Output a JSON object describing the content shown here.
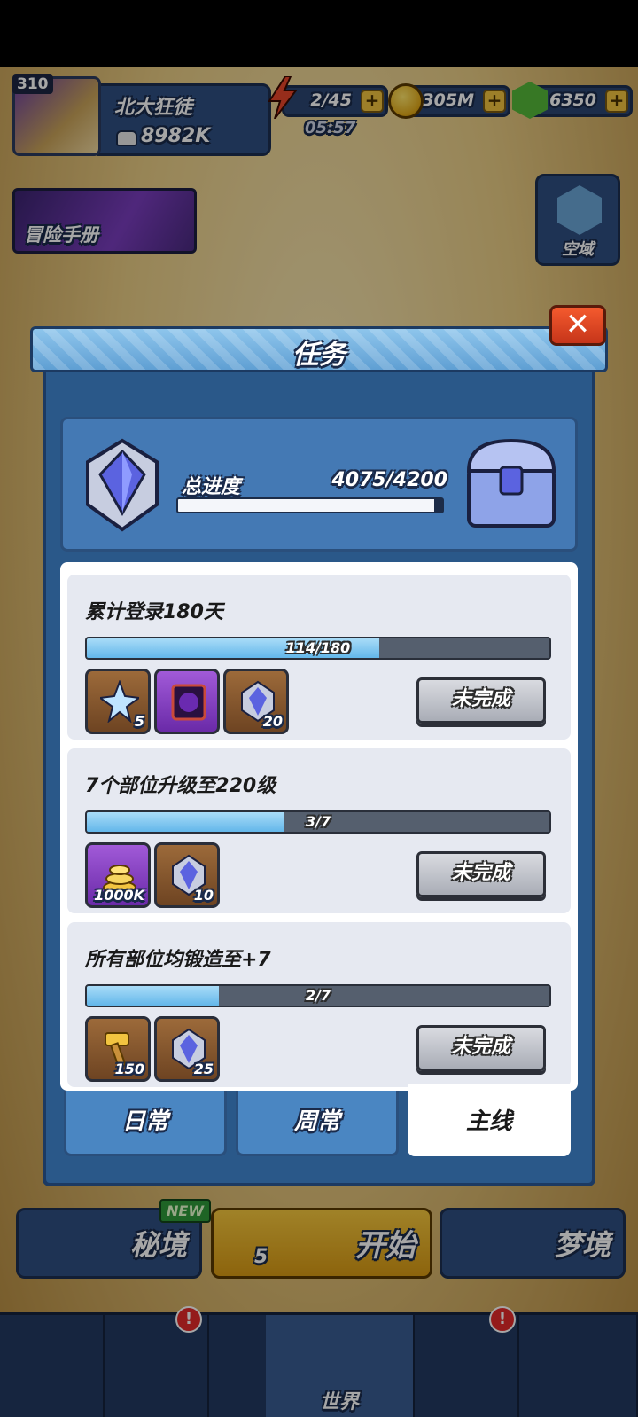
{
  "hud": {
    "level": "310",
    "player_name": "北大狂徒",
    "power": "8982K",
    "energy": "2/45",
    "energy_timer": "05:57",
    "gold": "305M",
    "gems": "6350",
    "plus_label": "+",
    "adventure_book": "冒险手册",
    "airspace": "空域"
  },
  "modal": {
    "title": "任务",
    "close_label": "✕",
    "total_progress_label": "总进度",
    "total_progress_value": "4075/4200",
    "total_progress_fraction": 0.97
  },
  "tasks": [
    {
      "title": "累计登录180天",
      "progress_text": "114/180",
      "progress_fraction": 0.633,
      "rewards": [
        {
          "icon": "star-shard-icon",
          "count": "5",
          "style": "brown"
        },
        {
          "icon": "dark-portal-frame-icon",
          "count": "",
          "style": "purple"
        },
        {
          "icon": "crystal-badge-icon",
          "count": "20",
          "style": "brown"
        }
      ],
      "status": "未完成"
    },
    {
      "title": "7个部位升级至220级",
      "progress_text": "3/7",
      "progress_fraction": 0.428,
      "rewards": [
        {
          "icon": "gold-coin-pile-icon",
          "count": "1000K",
          "style": "purple"
        },
        {
          "icon": "crystal-badge-icon",
          "count": "10",
          "style": "brown"
        }
      ],
      "status": "未完成"
    },
    {
      "title": "所有部位均锻造至+7",
      "progress_text": "2/7",
      "progress_fraction": 0.286,
      "rewards": [
        {
          "icon": "hammer-icon",
          "count": "150",
          "style": "brown"
        },
        {
          "icon": "crystal-badge-icon",
          "count": "25",
          "style": "brown"
        }
      ],
      "status": "未完成"
    }
  ],
  "tabs": [
    {
      "label": "日常"
    },
    {
      "label": "周常"
    },
    {
      "label": "主线",
      "active": true
    }
  ],
  "lower": {
    "secret": "秘境",
    "new_tag": "NEW",
    "start": "开始",
    "start_cost": "5",
    "dream": "梦境"
  },
  "nav": {
    "world": "世界",
    "badge": "!"
  },
  "colors": {
    "panel": "#2a5889",
    "card": "#4479b4",
    "bar_fill": "#63b7ea",
    "close": "#e0451f",
    "button_gray": "#a9adb6"
  }
}
